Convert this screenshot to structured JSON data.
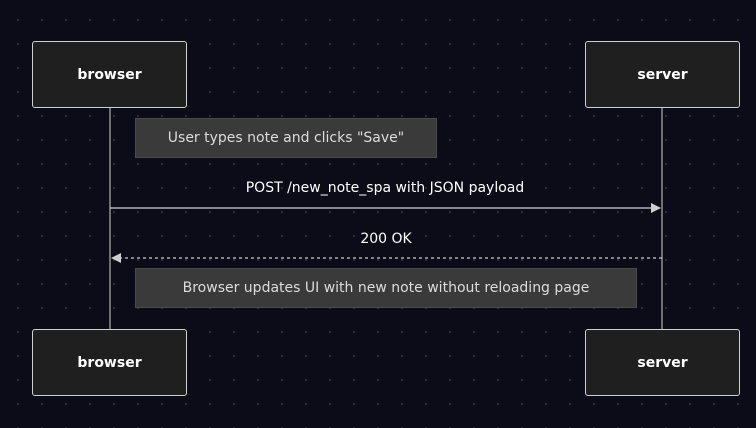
{
  "participants": {
    "browser": "browser",
    "server": "server"
  },
  "notes": {
    "first": "User types note and clicks \"Save\"",
    "second": "Browser updates UI with new note without reloading page"
  },
  "messages": {
    "request": "POST /new_note_spa with JSON payload",
    "response": "200 OK"
  },
  "colors": {
    "background": "#0c0c18",
    "actor_fill": "#1f1f1f",
    "actor_border": "#cfcfcf",
    "note_fill": "#3a3a3a",
    "line": "#cfcfcf"
  }
}
